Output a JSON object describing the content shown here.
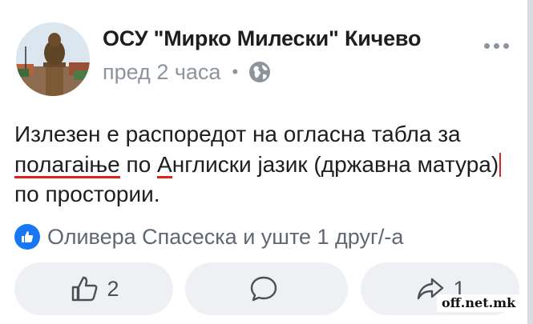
{
  "post": {
    "author": "ОСУ \"Мирко Милески\" Кичево",
    "time": "пред 2 часа",
    "separator": "•",
    "privacy_icon": "globe-icon",
    "menu_icon": "more-icon",
    "body": {
      "t1": "Излезен е распоредот на огласна табла за ",
      "w1": "полагаіње",
      "t2": " по ",
      "w2": "А",
      "t3": "нглиски јазик (државна матура)",
      "t4": "по простории."
    }
  },
  "reactions": {
    "icon": "like-badge-icon",
    "text": "Оливера Спасеска и уште 1 друг/-а"
  },
  "actions": {
    "like_count": "2",
    "comment_count": "",
    "share_count": "1"
  },
  "watermark": "off.net.mk",
  "colors": {
    "accent": "#1877f2",
    "spellcheck": "#e0221f",
    "secondary_text": "#8d949e"
  }
}
